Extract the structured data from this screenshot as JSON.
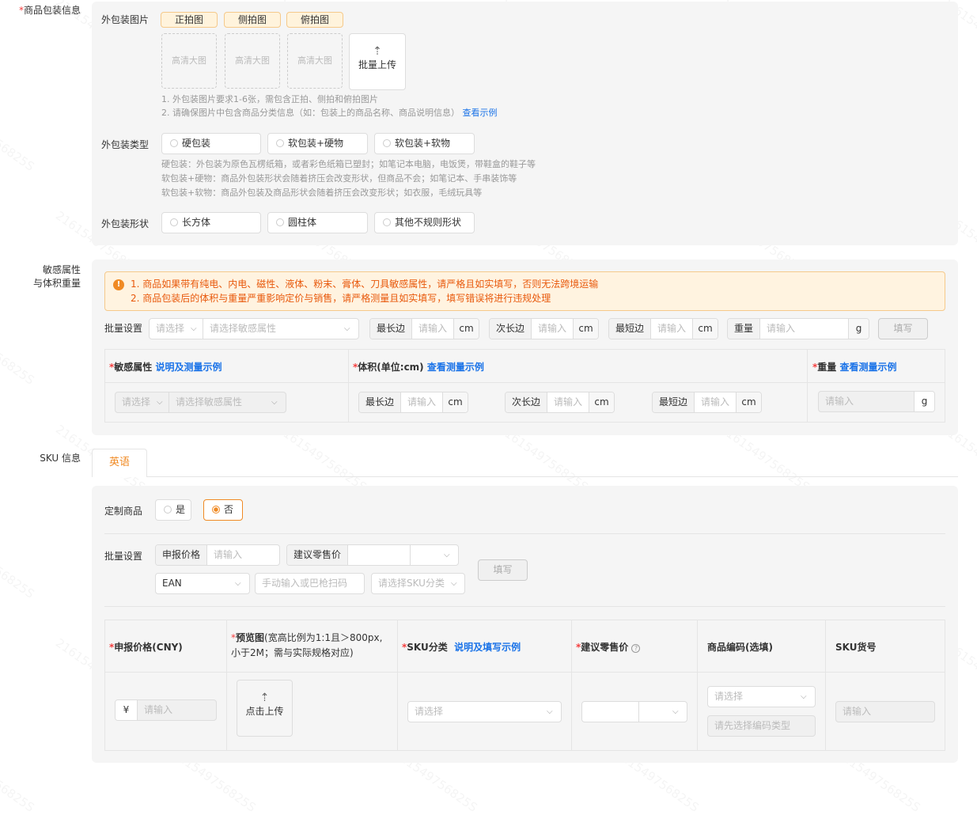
{
  "packaging": {
    "label": "商品包装信息",
    "images_label": "外包装图片",
    "tags": [
      "正拍图",
      "侧拍图",
      "俯拍图"
    ],
    "placeholder": "高清大图",
    "upload_label": "批量上传",
    "hint1": "1. 外包装图片要求1-6张，需包含正拍、侧拍和俯拍图片",
    "hint2": "2. 请确保图片中包含商品分类信息（如：包装上的商品名称、商品说明信息）",
    "example_link": "查看示例",
    "type_label": "外包装类型",
    "types": [
      "硬包装",
      "软包装+硬物",
      "软包装+软物"
    ],
    "type_hints": [
      "硬包装：外包装为原色瓦楞纸箱，或者彩色纸箱已塑封；如笔记本电脑，电饭煲，带鞋盒的鞋子等",
      "软包装+硬物：商品外包装形状会随着挤压会改变形状，但商品不会；如笔记本、手串装饰等",
      "软包装+软物：商品外包装及商品形状会随着挤压会改变形状；如衣服，毛绒玩具等"
    ],
    "shape_label": "外包装形状",
    "shapes": [
      "长方体",
      "圆柱体",
      "其他不规则形状"
    ]
  },
  "attributes": {
    "label_line1": "敏感属性",
    "label_line2": "与体积重量",
    "alerts": [
      "1.  商品如果带有纯电、内电、磁性、液体、粉末、膏体、刀具敏感属性，请严格且如实填写，否则无法跨境运输",
      "2.  商品包装后的体积与重量严重影响定价与销售，请严格测量且如实填写，填写错误将进行违规处理"
    ],
    "batch_label": "批量设置",
    "select_ph": "请选择",
    "sensitive_ph": "请选择敏感属性",
    "longest": "最长边",
    "middle": "次长边",
    "shortest": "最短边",
    "weight": "重量",
    "input_ph": "请输入",
    "cm": "cm",
    "g": "g",
    "fill_btn": "填写",
    "col_sensitive": "敏感属性",
    "col_sensitive_link": "说明及测量示例",
    "col_volume": "体积(单位:cm)",
    "col_volume_link": "查看测量示例",
    "col_weight": "重量",
    "col_weight_link": "查看测量示例"
  },
  "sku": {
    "label": "SKU 信息",
    "tab": "英语",
    "custom_label": "定制商品",
    "yes": "是",
    "no": "否",
    "batch_label": "批量设置",
    "declare_price": "申报价格",
    "input_ph": "请输入",
    "suggest_price": "建议零售价",
    "ean": "EAN",
    "scan_ph": "手动输入或巴枪扫码",
    "sku_cat_ph": "请选择SKU分类",
    "fill_btn": "填写",
    "col_price": "申报价格(CNY)",
    "col_preview_a": "预览图",
    "col_preview_b": "(宽高比例为1:1且＞800px,",
    "col_preview_c": "小于2M；需与实际规格对应)",
    "col_cat": "SKU分类",
    "col_cat_link": "说明及填写示例",
    "col_retail": "建议零售价",
    "col_code": "商品编码(选填)",
    "col_sku_no": "SKU货号",
    "yen": "¥",
    "click_upload": "点击上传",
    "select_ph": "请选择",
    "code_type_ph": "请先选择编码类型"
  },
  "watermark": "2161549756825S"
}
